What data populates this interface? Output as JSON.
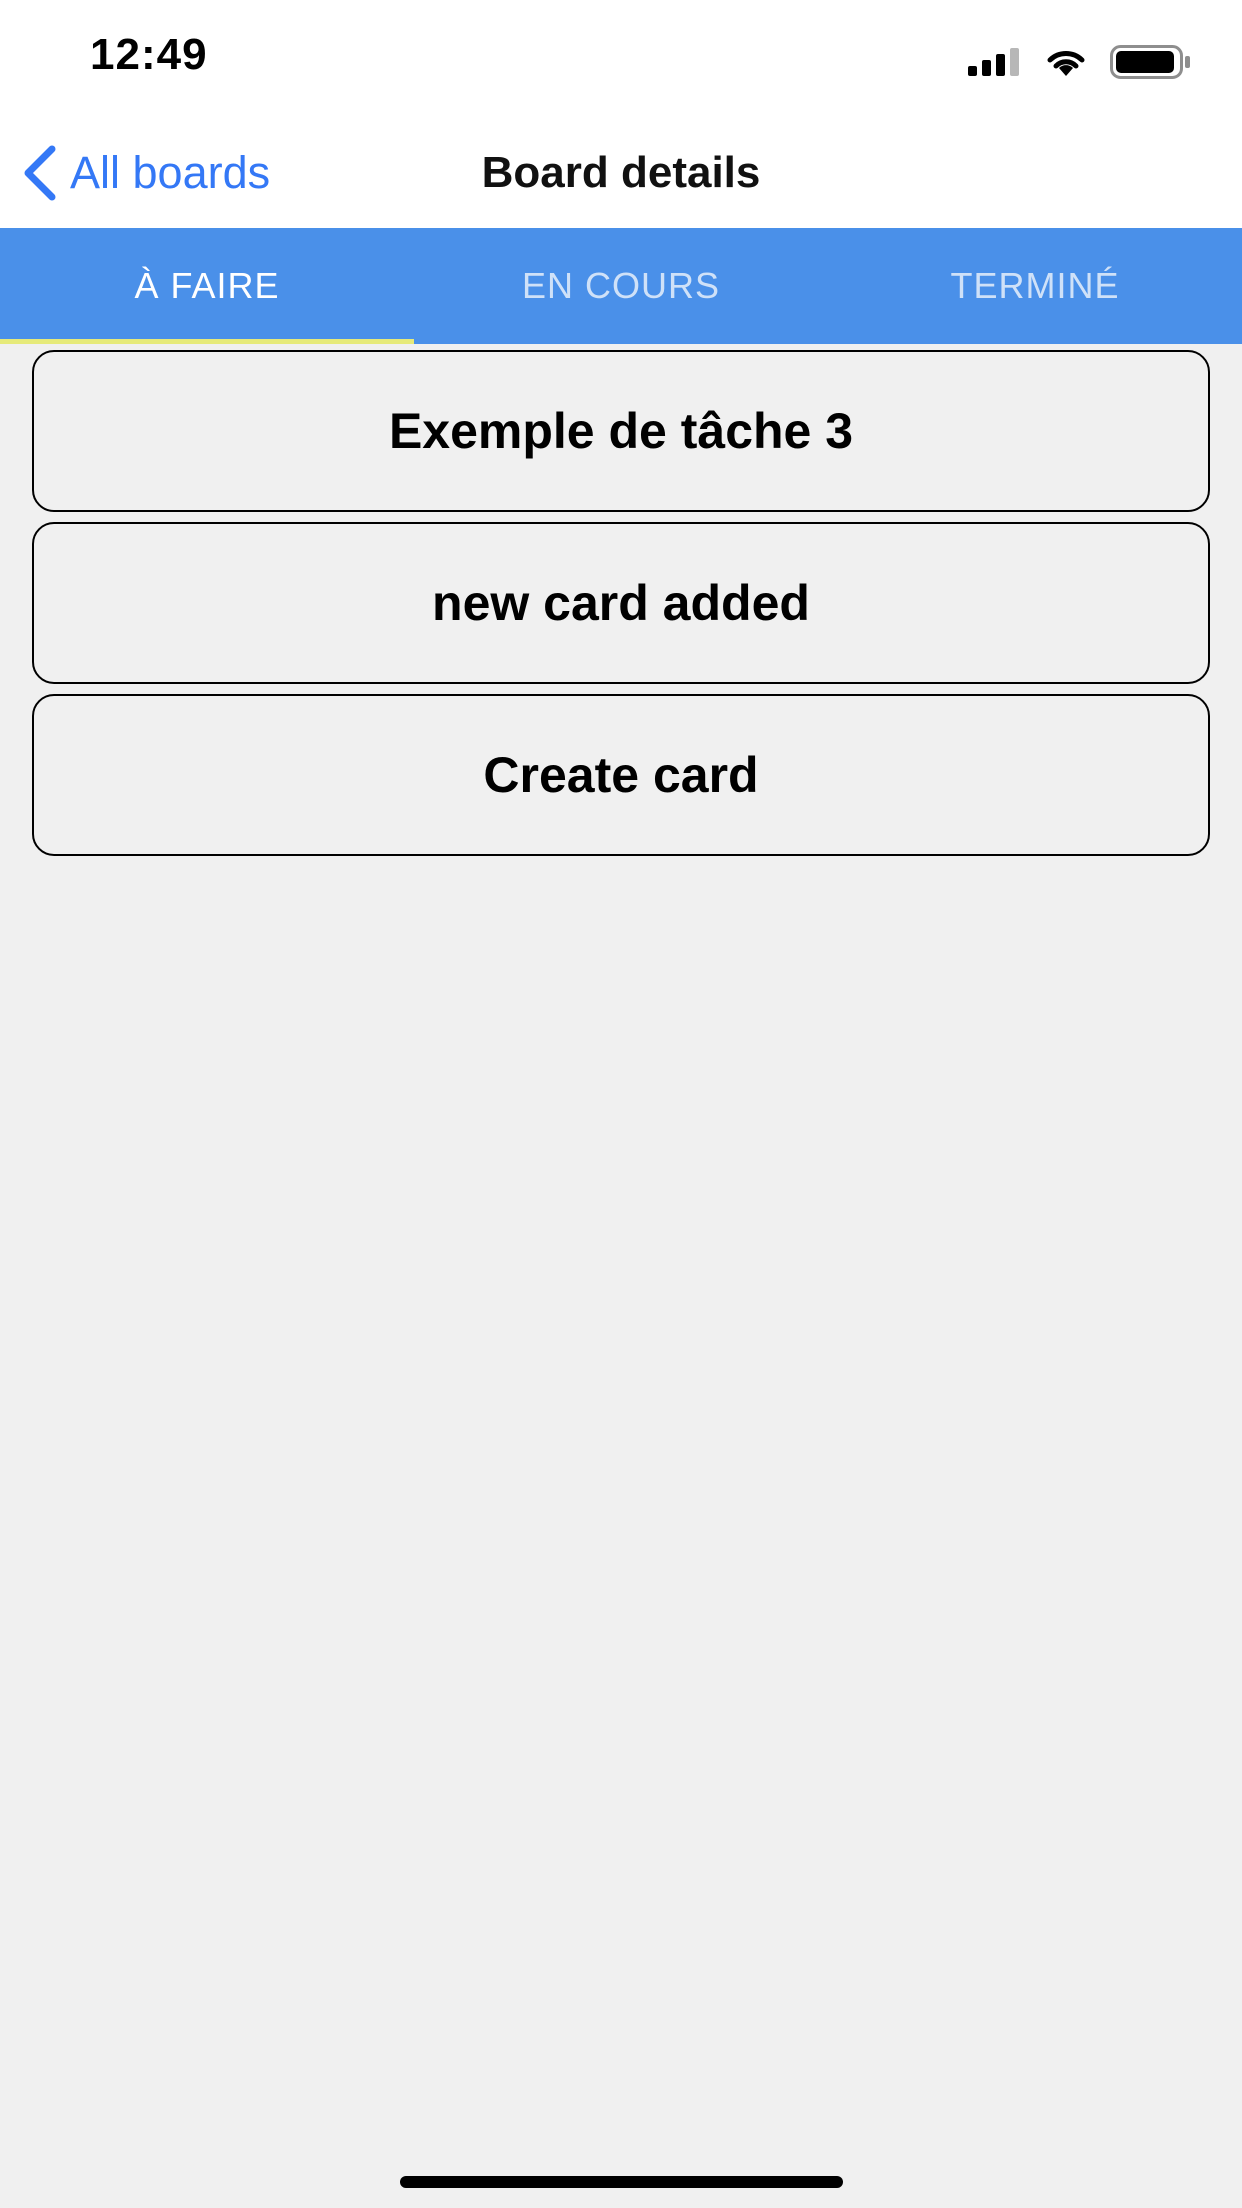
{
  "status_bar": {
    "time": "12:49",
    "icons": [
      "signal-icon",
      "wifi-icon",
      "battery-icon"
    ]
  },
  "nav": {
    "back_label": "All boards",
    "title": "Board details",
    "accent_color": "#3478f6"
  },
  "tabs": [
    {
      "label": "À FAIRE",
      "active": true
    },
    {
      "label": "EN COURS",
      "active": false
    },
    {
      "label": "TERMINÉ",
      "active": false
    }
  ],
  "tab_bar_color": "#4a90e9",
  "cards": [
    {
      "title": "Exemple de tâche 3"
    },
    {
      "title": "new card added"
    }
  ],
  "create_card_label": "Create card"
}
